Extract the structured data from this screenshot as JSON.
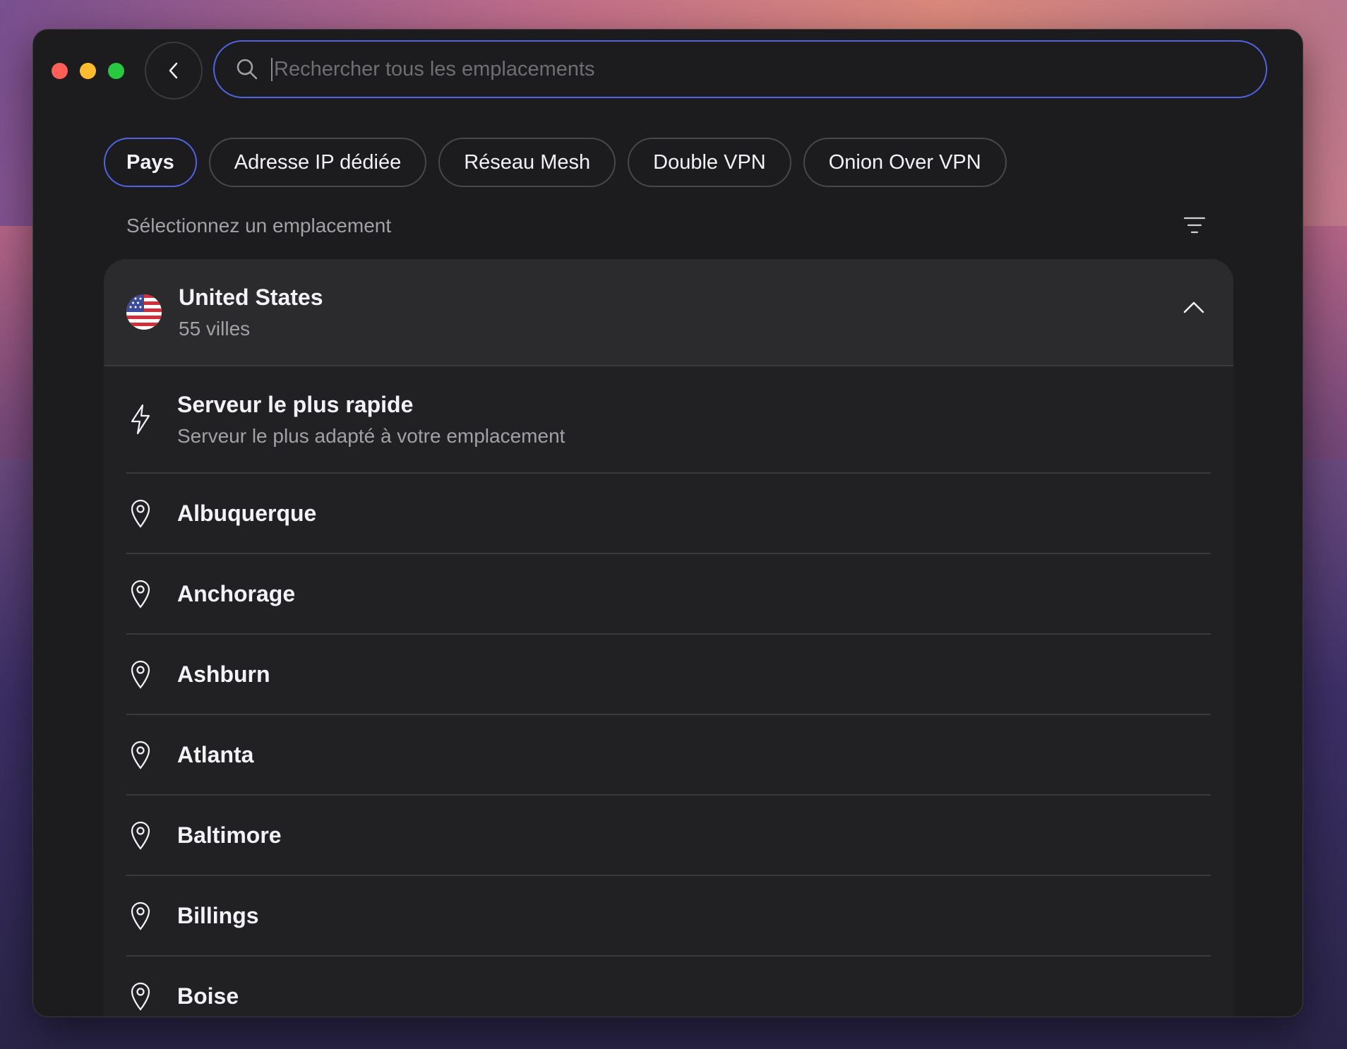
{
  "search": {
    "placeholder": "Rechercher tous les emplacements"
  },
  "tabs": [
    {
      "label": "Pays",
      "active": true
    },
    {
      "label": "Adresse IP dédiée",
      "active": false
    },
    {
      "label": "Réseau Mesh",
      "active": false
    },
    {
      "label": "Double VPN",
      "active": false
    },
    {
      "label": "Onion Over VPN",
      "active": false
    }
  ],
  "section_label": "Sélectionnez un emplacement",
  "country": {
    "name": "United States",
    "subtitle": "55 villes",
    "flag_icon": "us-flag-icon"
  },
  "fastest": {
    "title": "Serveur le plus rapide",
    "subtitle": "Serveur le plus adapté à votre emplacement"
  },
  "cities": [
    "Albuquerque",
    "Anchorage",
    "Ashburn",
    "Atlanta",
    "Baltimore",
    "Billings",
    "Boise"
  ],
  "colors": {
    "accent": "#4f63e3",
    "background": "#1c1c1e",
    "card": "#212124",
    "card_header": "#2b2b2e"
  }
}
